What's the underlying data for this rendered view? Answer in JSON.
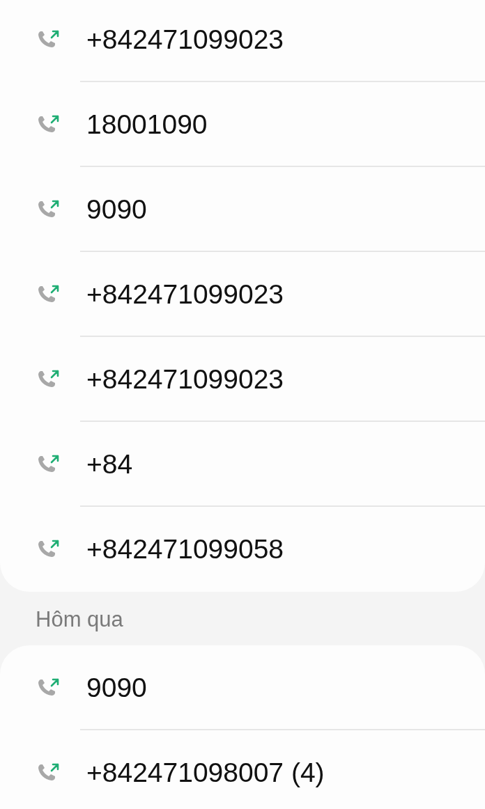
{
  "sections": [
    {
      "calls": [
        {
          "number": "+842471099023",
          "kind": "outgoing"
        },
        {
          "number": "18001090",
          "kind": "outgoing"
        },
        {
          "number": "9090",
          "kind": "outgoing"
        },
        {
          "number": "+842471099023",
          "kind": "outgoing"
        },
        {
          "number": "+842471099023",
          "kind": "outgoing"
        },
        {
          "number": "+84",
          "kind": "outgoing"
        },
        {
          "number": "+842471099058",
          "kind": "outgoing"
        }
      ]
    },
    {
      "header": "Hôm qua",
      "calls": [
        {
          "number": "9090",
          "kind": "outgoing"
        },
        {
          "number": "+842471098007 (4)",
          "kind": "outgoing"
        }
      ]
    }
  ]
}
